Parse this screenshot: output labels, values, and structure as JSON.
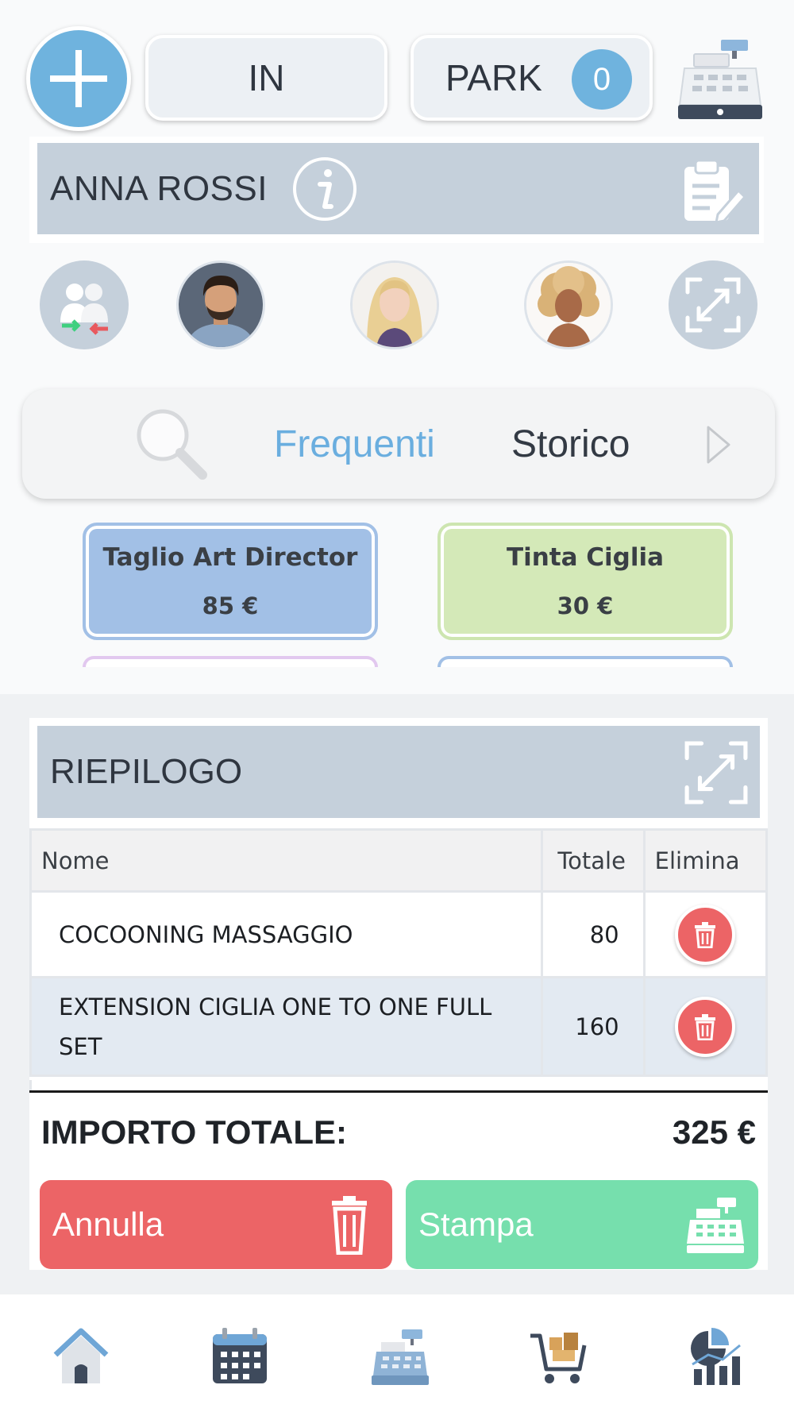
{
  "topbar": {
    "in_label": "IN",
    "park_label": "PARK",
    "park_count": "0",
    "icons": [
      "plus-icon",
      "cash-register-icon"
    ]
  },
  "client": {
    "name": "ANNA ROSSI",
    "icons": [
      "info-icon",
      "clipboard-edit-icon"
    ]
  },
  "avatars": [
    "swap-clients-icon",
    "staff-man",
    "staff-blonde-woman",
    "staff-curly-woman",
    "expand-icon"
  ],
  "tabs": {
    "frequenti": "Frequenti",
    "storico": "Storico"
  },
  "services": [
    {
      "name": "Taglio Art Director",
      "price": "85 €",
      "color": "#a2c0e6"
    },
    {
      "name": "Tinta Ciglia",
      "price": "30 €",
      "color": "#d4e9b8"
    }
  ],
  "summary": {
    "title": "RIEPILOGO",
    "columns": {
      "name": "Nome",
      "total": "Totale",
      "delete": "Elimina"
    },
    "rows": [
      {
        "name": "COCOONING MASSAGGIO",
        "total": "80"
      },
      {
        "name": "EXTENSION CIGLIA ONE TO ONE FULL SET",
        "total": "160"
      }
    ],
    "total_label": "IMPORTO TOTALE:",
    "total_value": "325 €"
  },
  "actions": {
    "cancel": "Annulla",
    "print": "Stampa"
  },
  "bottom_nav": [
    "home-icon",
    "calendar-icon",
    "cash-register-icon",
    "shopping-cart-icon",
    "statistics-icon"
  ],
  "colors": {
    "accent": "#6fb3de",
    "cancel": "#ec6466",
    "print": "#76dfad",
    "bar": "#c5d0db"
  }
}
